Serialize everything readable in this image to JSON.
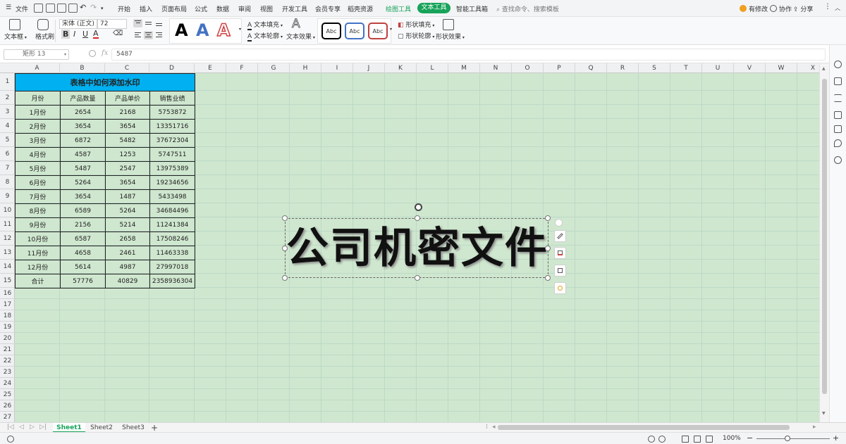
{
  "menubar": {
    "file": "文件",
    "tabs": [
      "开始",
      "插入",
      "页面布局",
      "公式",
      "数据",
      "审阅",
      "视图",
      "开发工具",
      "会员专享",
      "稻壳资源"
    ],
    "context_tab_draw": "绘图工具",
    "context_tab_text": "文本工具",
    "smart_tools": "智能工具箱",
    "search_placeholder": "查找命令、搜索模板",
    "modified": "有修改",
    "collaborate": "协作",
    "share": "分享"
  },
  "ribbon": {
    "textbox": "文本框",
    "format_painter": "格式刷",
    "font_name": "宋体 (正文)",
    "font_size": "72",
    "text_fill": "文本填充",
    "text_outline": "文本轮廓",
    "text_effect": "文本效果",
    "shape_fill": "形状填充",
    "shape_outline": "形状轮廓",
    "shape_effect": "形状效果",
    "bold": "B",
    "italic": "I",
    "underline": "U",
    "font_color": "A",
    "big_a": "A",
    "style_sample": "Abc"
  },
  "formula_bar": {
    "name_box": "矩形 13",
    "fx": "fx",
    "value": "5487"
  },
  "grid": {
    "columns": [
      "A",
      "B",
      "C",
      "D",
      "E",
      "F",
      "G",
      "H",
      "I",
      "J",
      "K",
      "L",
      "M",
      "N",
      "O",
      "P",
      "Q",
      "R",
      "S",
      "T",
      "U",
      "V",
      "W",
      "X"
    ],
    "rows": [
      "1",
      "2",
      "3",
      "4",
      "5",
      "6",
      "7",
      "8",
      "9",
      "10",
      "11",
      "12",
      "13",
      "14",
      "15",
      "16",
      "17",
      "18",
      "19",
      "20",
      "21",
      "22",
      "23",
      "24",
      "25",
      "26",
      "27"
    ]
  },
  "table": {
    "title": "表格中如何添加水印",
    "headers": [
      "月份",
      "产品数量",
      "产品单价",
      "销售业绩"
    ],
    "rows": [
      [
        "1月份",
        "2654",
        "2168",
        "5753872"
      ],
      [
        "2月份",
        "3654",
        "3654",
        "13351716"
      ],
      [
        "3月份",
        "6872",
        "5482",
        "37672304"
      ],
      [
        "4月份",
        "4587",
        "1253",
        "5747511"
      ],
      [
        "5月份",
        "5487",
        "2547",
        "13975389"
      ],
      [
        "6月份",
        "5264",
        "3654",
        "19234656"
      ],
      [
        "7月份",
        "3654",
        "1487",
        "5433498"
      ],
      [
        "8月份",
        "6589",
        "5264",
        "34684496"
      ],
      [
        "9月份",
        "2156",
        "5214",
        "11241384"
      ],
      [
        "10月份",
        "6587",
        "2658",
        "17508246"
      ],
      [
        "11月份",
        "4658",
        "2461",
        "11463338"
      ],
      [
        "12月份",
        "5614",
        "4987",
        "27997018"
      ],
      [
        "合计",
        "57776",
        "40829",
        "2358936304"
      ]
    ]
  },
  "watermark": {
    "text": "公司机密文件"
  },
  "sheets": [
    "Sheet1",
    "Sheet2",
    "Sheet3"
  ],
  "sheet_add": "+",
  "statusbar": {
    "zoom": "100%",
    "zoom_level_percent": 100,
    "minus": "−",
    "plus": "+"
  },
  "colors": {
    "accent": "#17a35a",
    "title_fill": "#00b0f0",
    "sheet_bg": "#cfe7cf"
  }
}
